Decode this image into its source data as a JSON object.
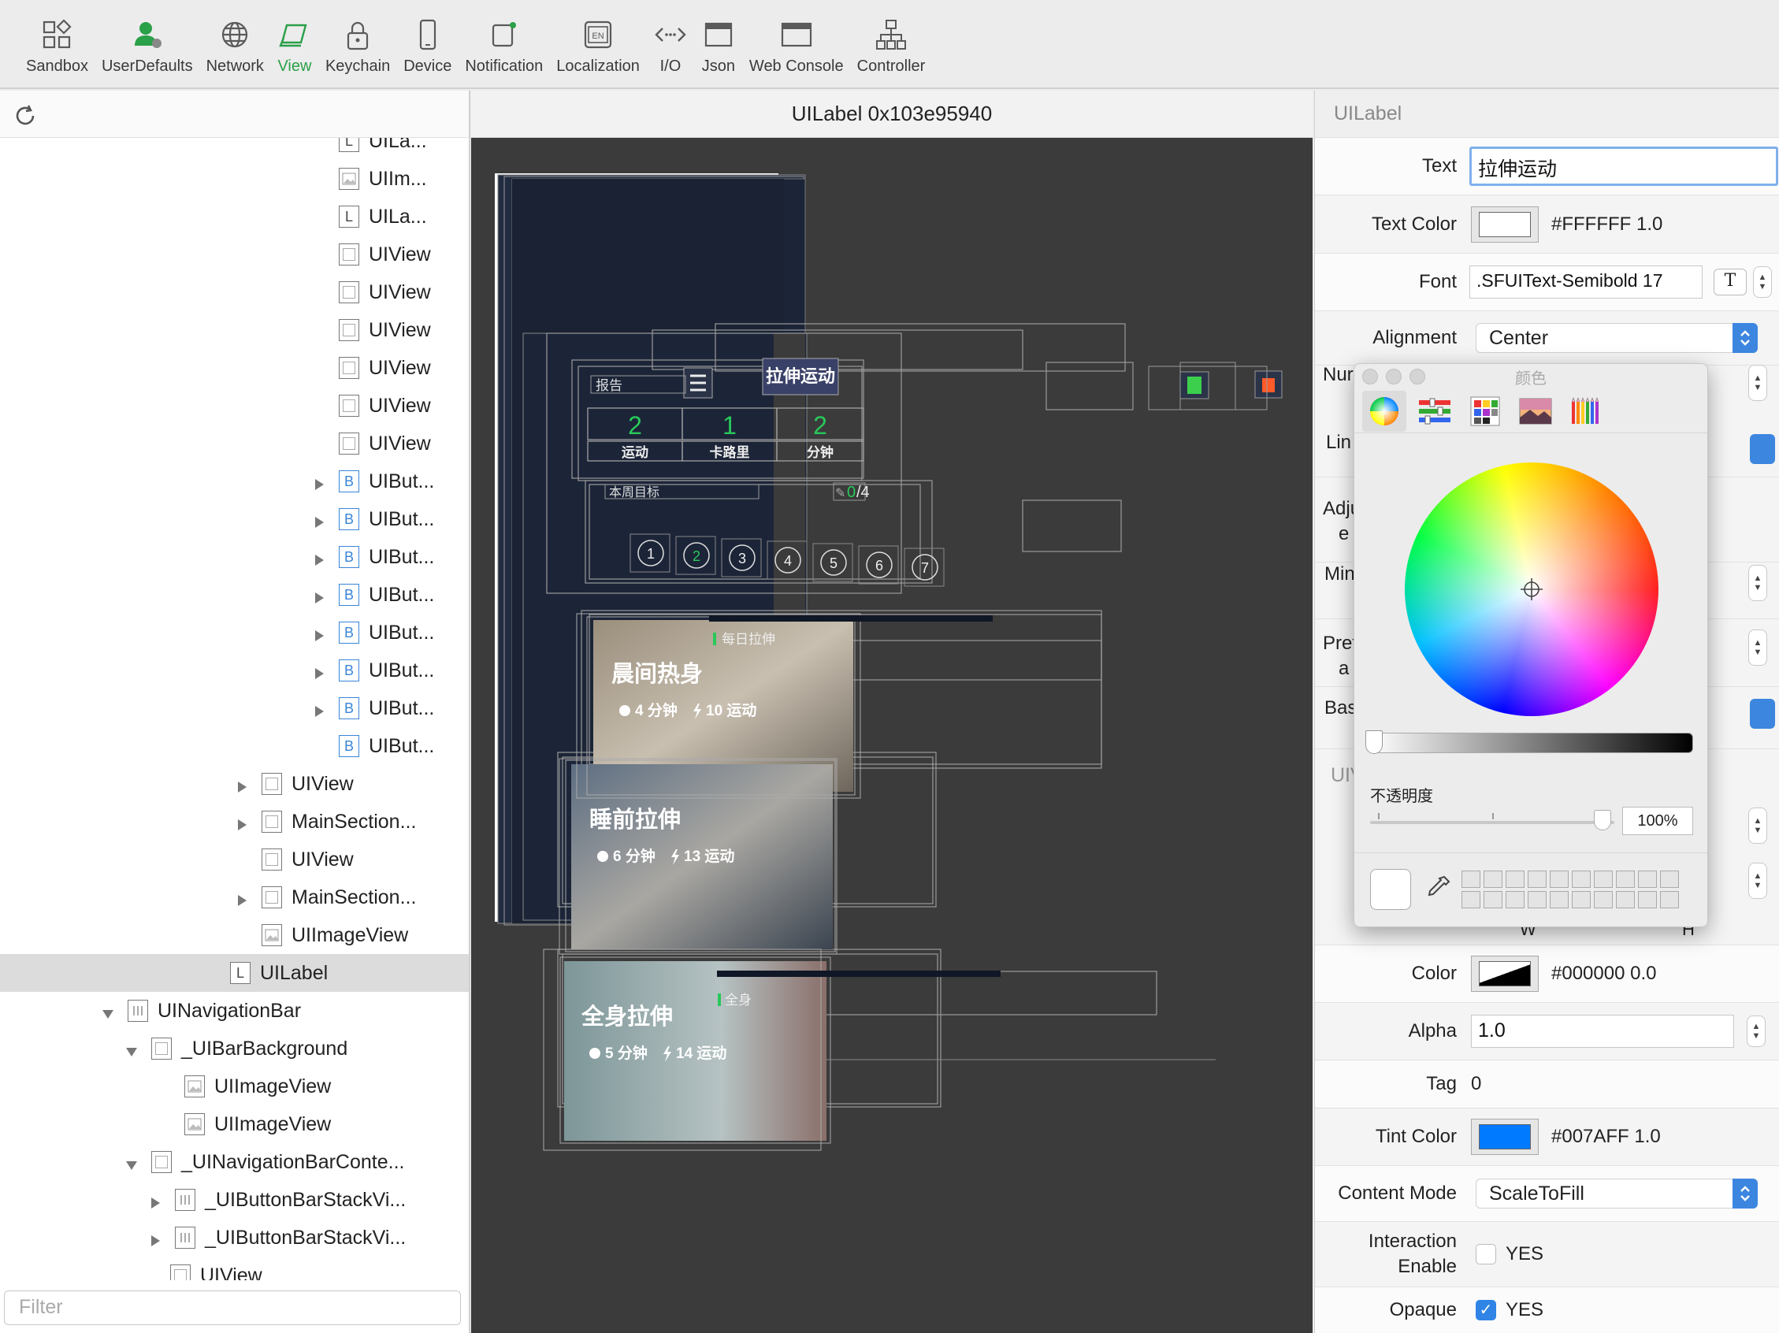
{
  "toolbar": {
    "items": [
      {
        "label": "Sandbox",
        "icon": "sandbox-icon",
        "active": false
      },
      {
        "label": "UserDefaults",
        "icon": "userdefaults-icon",
        "active": false
      },
      {
        "label": "Network",
        "icon": "globe-icon",
        "active": false
      },
      {
        "label": "View",
        "icon": "view-layers-icon",
        "active": true
      },
      {
        "label": "Keychain",
        "icon": "lock-icon",
        "active": false
      },
      {
        "label": "Device",
        "icon": "phone-icon",
        "active": false
      },
      {
        "label": "Notification",
        "icon": "notification-icon",
        "active": false
      },
      {
        "label": "Localization",
        "icon": "localization-icon",
        "active": false
      },
      {
        "label": "I/O",
        "icon": "io-icon",
        "active": false
      },
      {
        "label": "Json",
        "icon": "json-window-icon",
        "active": false
      },
      {
        "label": "Web Console",
        "icon": "web-console-icon",
        "active": false
      },
      {
        "label": "Controller",
        "icon": "controller-hierarchy-icon",
        "active": false
      }
    ],
    "active_color": "#2aa048"
  },
  "tree": {
    "filter_placeholder": "Filter",
    "rows": [
      {
        "label": "UILa...",
        "badge": "L",
        "kind": "label",
        "indent": 0,
        "expand": "",
        "clipped": true
      },
      {
        "label": "UIIm...",
        "badge": "",
        "kind": "img",
        "indent": 0,
        "expand": ""
      },
      {
        "label": "UILa...",
        "badge": "L",
        "kind": "label",
        "indent": 0,
        "expand": ""
      },
      {
        "label": "UIView",
        "badge": "",
        "kind": "box",
        "indent": 0,
        "expand": ""
      },
      {
        "label": "UIView",
        "badge": "",
        "kind": "box",
        "indent": 0,
        "expand": ""
      },
      {
        "label": "UIView",
        "badge": "",
        "kind": "box",
        "indent": 0,
        "expand": ""
      },
      {
        "label": "UIView",
        "badge": "",
        "kind": "box",
        "indent": 0,
        "expand": ""
      },
      {
        "label": "UIView",
        "badge": "",
        "kind": "box",
        "indent": 0,
        "expand": ""
      },
      {
        "label": "UIView",
        "badge": "",
        "kind": "box",
        "indent": 0,
        "expand": ""
      },
      {
        "label": "UIBut...",
        "badge": "B",
        "kind": "b",
        "indent": 0,
        "expand": "collapsed"
      },
      {
        "label": "UIBut...",
        "badge": "B",
        "kind": "b",
        "indent": 0,
        "expand": "collapsed"
      },
      {
        "label": "UIBut...",
        "badge": "B",
        "kind": "b",
        "indent": 0,
        "expand": "collapsed"
      },
      {
        "label": "UIBut...",
        "badge": "B",
        "kind": "b",
        "indent": 0,
        "expand": "collapsed"
      },
      {
        "label": "UIBut...",
        "badge": "B",
        "kind": "b",
        "indent": 0,
        "expand": "collapsed"
      },
      {
        "label": "UIBut...",
        "badge": "B",
        "kind": "b",
        "indent": 0,
        "expand": "collapsed"
      },
      {
        "label": "UIBut...",
        "badge": "B",
        "kind": "b",
        "indent": 0,
        "expand": "collapsed"
      },
      {
        "label": "UIBut...",
        "badge": "B",
        "kind": "b",
        "indent": 0,
        "expand": ""
      },
      {
        "label": "UIView",
        "badge": "",
        "kind": "box",
        "indent": 1,
        "expand": "collapsed"
      },
      {
        "label": "MainSection...",
        "badge": "",
        "kind": "box",
        "indent": 1,
        "expand": "collapsed"
      },
      {
        "label": "UIView",
        "badge": "",
        "kind": "box",
        "indent": 1,
        "expand": ""
      },
      {
        "label": "MainSection...",
        "badge": "",
        "kind": "box",
        "indent": 1,
        "expand": "collapsed"
      },
      {
        "label": "UIImageView",
        "badge": "",
        "kind": "img",
        "indent": 1,
        "expand": ""
      },
      {
        "label": "UILabel",
        "badge": "L",
        "kind": "label",
        "indent": 2,
        "expand": "",
        "selected": true
      },
      {
        "label": "UINavigationBar",
        "badge": "",
        "kind": "bar",
        "indent": 3,
        "expand": "expanded"
      },
      {
        "label": "_UIBarBackground",
        "badge": "",
        "kind": "box",
        "indent": 4,
        "expand": "expanded"
      },
      {
        "label": "UIImageView",
        "badge": "",
        "kind": "img",
        "indent": 5,
        "expand": ""
      },
      {
        "label": "UIImageView",
        "badge": "",
        "kind": "img",
        "indent": 5,
        "expand": ""
      },
      {
        "label": "_UINavigationBarConte...",
        "badge": "",
        "kind": "box",
        "indent": 4,
        "expand": "expanded"
      },
      {
        "label": "_UIButtonBarStackVi...",
        "badge": "",
        "kind": "bar",
        "indent": 6,
        "expand": "collapsed"
      },
      {
        "label": "_UIButtonBarStackVi...",
        "badge": "",
        "kind": "bar",
        "indent": 6,
        "expand": "collapsed"
      },
      {
        "label": "UIView",
        "badge": "",
        "kind": "box",
        "indent": 7,
        "expand": ""
      }
    ]
  },
  "center": {
    "title": "UILabel  0x103e95940"
  },
  "preview": {
    "nav_title": "拉伸运动",
    "report_label": "报告",
    "stats": [
      {
        "value": "2",
        "label": "运动"
      },
      {
        "value": "1",
        "label": "卡路里"
      },
      {
        "value": "2",
        "label": "分钟"
      }
    ],
    "weekly_goal_label": "本周目标",
    "weekly_goal_progress_current": "0",
    "weekly_goal_progress_total": "/4",
    "days": [
      "1",
      "2",
      "3",
      "4",
      "5",
      "6",
      "7"
    ],
    "daily_tag": "每日拉伸",
    "cards": [
      {
        "title": "晨间热身",
        "minutes": "4 分钟",
        "moves": "10 运动"
      },
      {
        "title": "睡前拉伸",
        "minutes": "6 分钟",
        "moves": "13 运动"
      },
      {
        "title": "全身拉伸",
        "minutes": "5 分钟",
        "moves": "14 运动"
      }
    ],
    "partial_tag": "全身",
    "accent": "#28c95a",
    "bg": "#1c2538"
  },
  "inspector": {
    "title": "UILabel",
    "text_label": "Text",
    "text_value": "拉伸运动",
    "text_color_label": "Text Color",
    "text_color_value": "#FFFFFF 1.0",
    "text_color_hex": "#FFFFFF",
    "font_label": "Font",
    "font_value": ".SFUIText-Semibold 17",
    "font_button": "T",
    "alignment_label": "Alignment",
    "alignment_value": "Center",
    "partial_labels": [
      "Nur",
      "Lin",
      "Adju",
      "e",
      "Min",
      "Pref",
      "a",
      "Bas",
      "UIV"
    ],
    "w_label": "W",
    "h_label": "H",
    "color_label": "Color",
    "color_value": "#000000 0.0",
    "alpha_label": "Alpha",
    "alpha_value": "1.0",
    "tag_label": "Tag",
    "tag_value": "0",
    "tint_label": "Tint Color",
    "tint_value": "#007AFF 1.0",
    "tint_hex": "#007AFF",
    "content_mode_label": "Content Mode",
    "content_mode_value": "ScaleToFill",
    "interaction_label_1": "Interaction",
    "interaction_label_2": "Enable",
    "interaction_value": "YES",
    "interaction_checked": false,
    "opaque_label": "Opaque",
    "opaque_value": "YES",
    "opaque_checked": true
  },
  "color_picker": {
    "title": "颜色",
    "opacity_label": "不透明度",
    "opacity_value": "100%",
    "opacity_level": 1.0,
    "tabs": [
      "color-wheel-icon",
      "sliders-icon",
      "palettes-icon",
      "image-palette-icon",
      "pencils-icon"
    ]
  }
}
